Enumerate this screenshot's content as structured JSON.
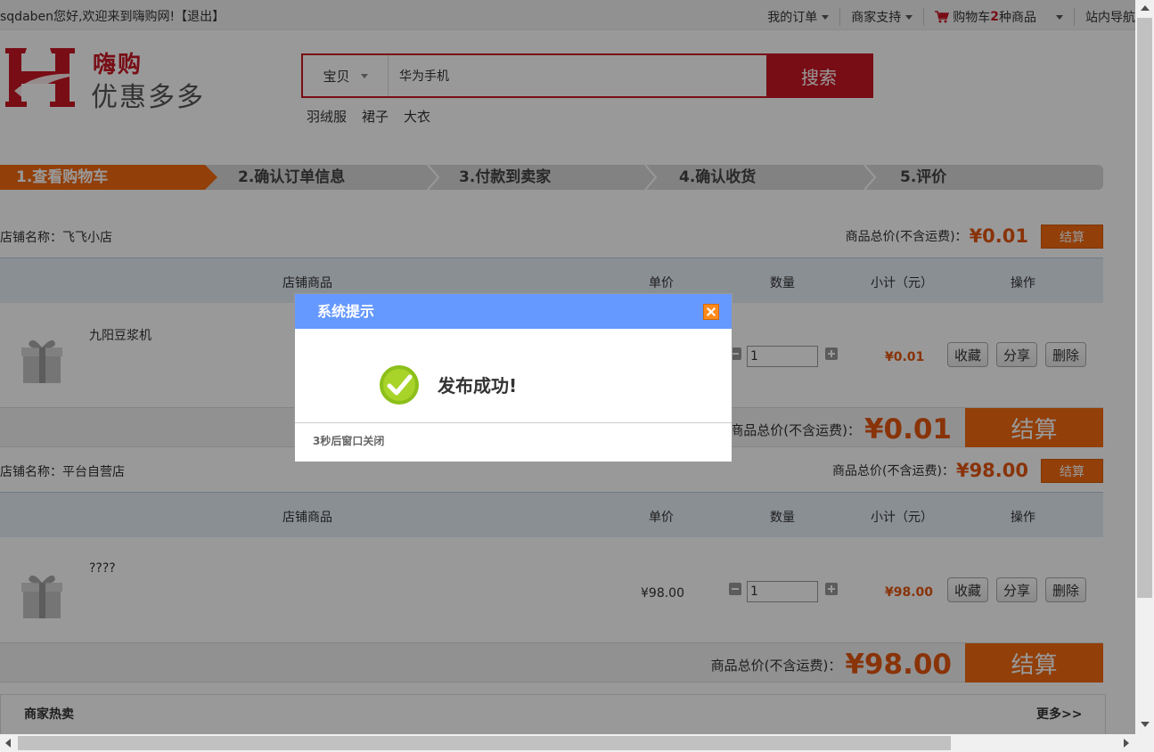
{
  "topbar": {
    "welcome": "sqdaben您好,欢迎来到嗨购网!【退出】",
    "my_orders": "我的订单",
    "merchant_support": "商家支持",
    "cart_label_pre": "购物车",
    "cart_count": "2",
    "cart_label_post": "种商品",
    "site_nav": "站内导航"
  },
  "header": {
    "logo_line1": "嗨购",
    "logo_line2": "优惠多多",
    "search_type": "宝贝",
    "search_value": "华为手机",
    "search_button": "搜索",
    "hotwords": [
      "羽绒服",
      "裙子",
      "大衣"
    ]
  },
  "steps": [
    "1.查看购物车",
    "2.确认订单信息",
    "3.付款到卖家",
    "4.确认收货",
    "5.评价"
  ],
  "table_headers": {
    "product": "店铺商品",
    "unit_price": "单价",
    "quantity": "数量",
    "subtotal": "小计（元）",
    "actions": "操作"
  },
  "buttons": {
    "favorite": "收藏",
    "share": "分享",
    "delete": "删除",
    "checkout": "结算"
  },
  "shops": [
    {
      "name": "店铺名称：飞飞小店",
      "total_label": "商品总价(不含运费)：",
      "total": "¥0.01",
      "product_name": "九阳豆浆机",
      "unit_price": "",
      "quantity": "1",
      "subtotal": "¥0.01"
    },
    {
      "name": "店铺名称：平台自营店",
      "total_label": "商品总价(不含运费)：",
      "total": "¥98.00",
      "product_name": "????",
      "unit_price": "¥98.00",
      "quantity": "1",
      "subtotal": "¥98.00"
    }
  ],
  "hot_panel": {
    "title": "商家热卖",
    "more": "更多>>"
  },
  "modal": {
    "title": "系统提示",
    "message": "发布成功!",
    "footer": "3秒后窗口关闭"
  },
  "colors": {
    "brand_red": "#c81623",
    "accent_orange": "#f36a10",
    "modal_header": "#6699ff",
    "price": "#e4550f"
  }
}
